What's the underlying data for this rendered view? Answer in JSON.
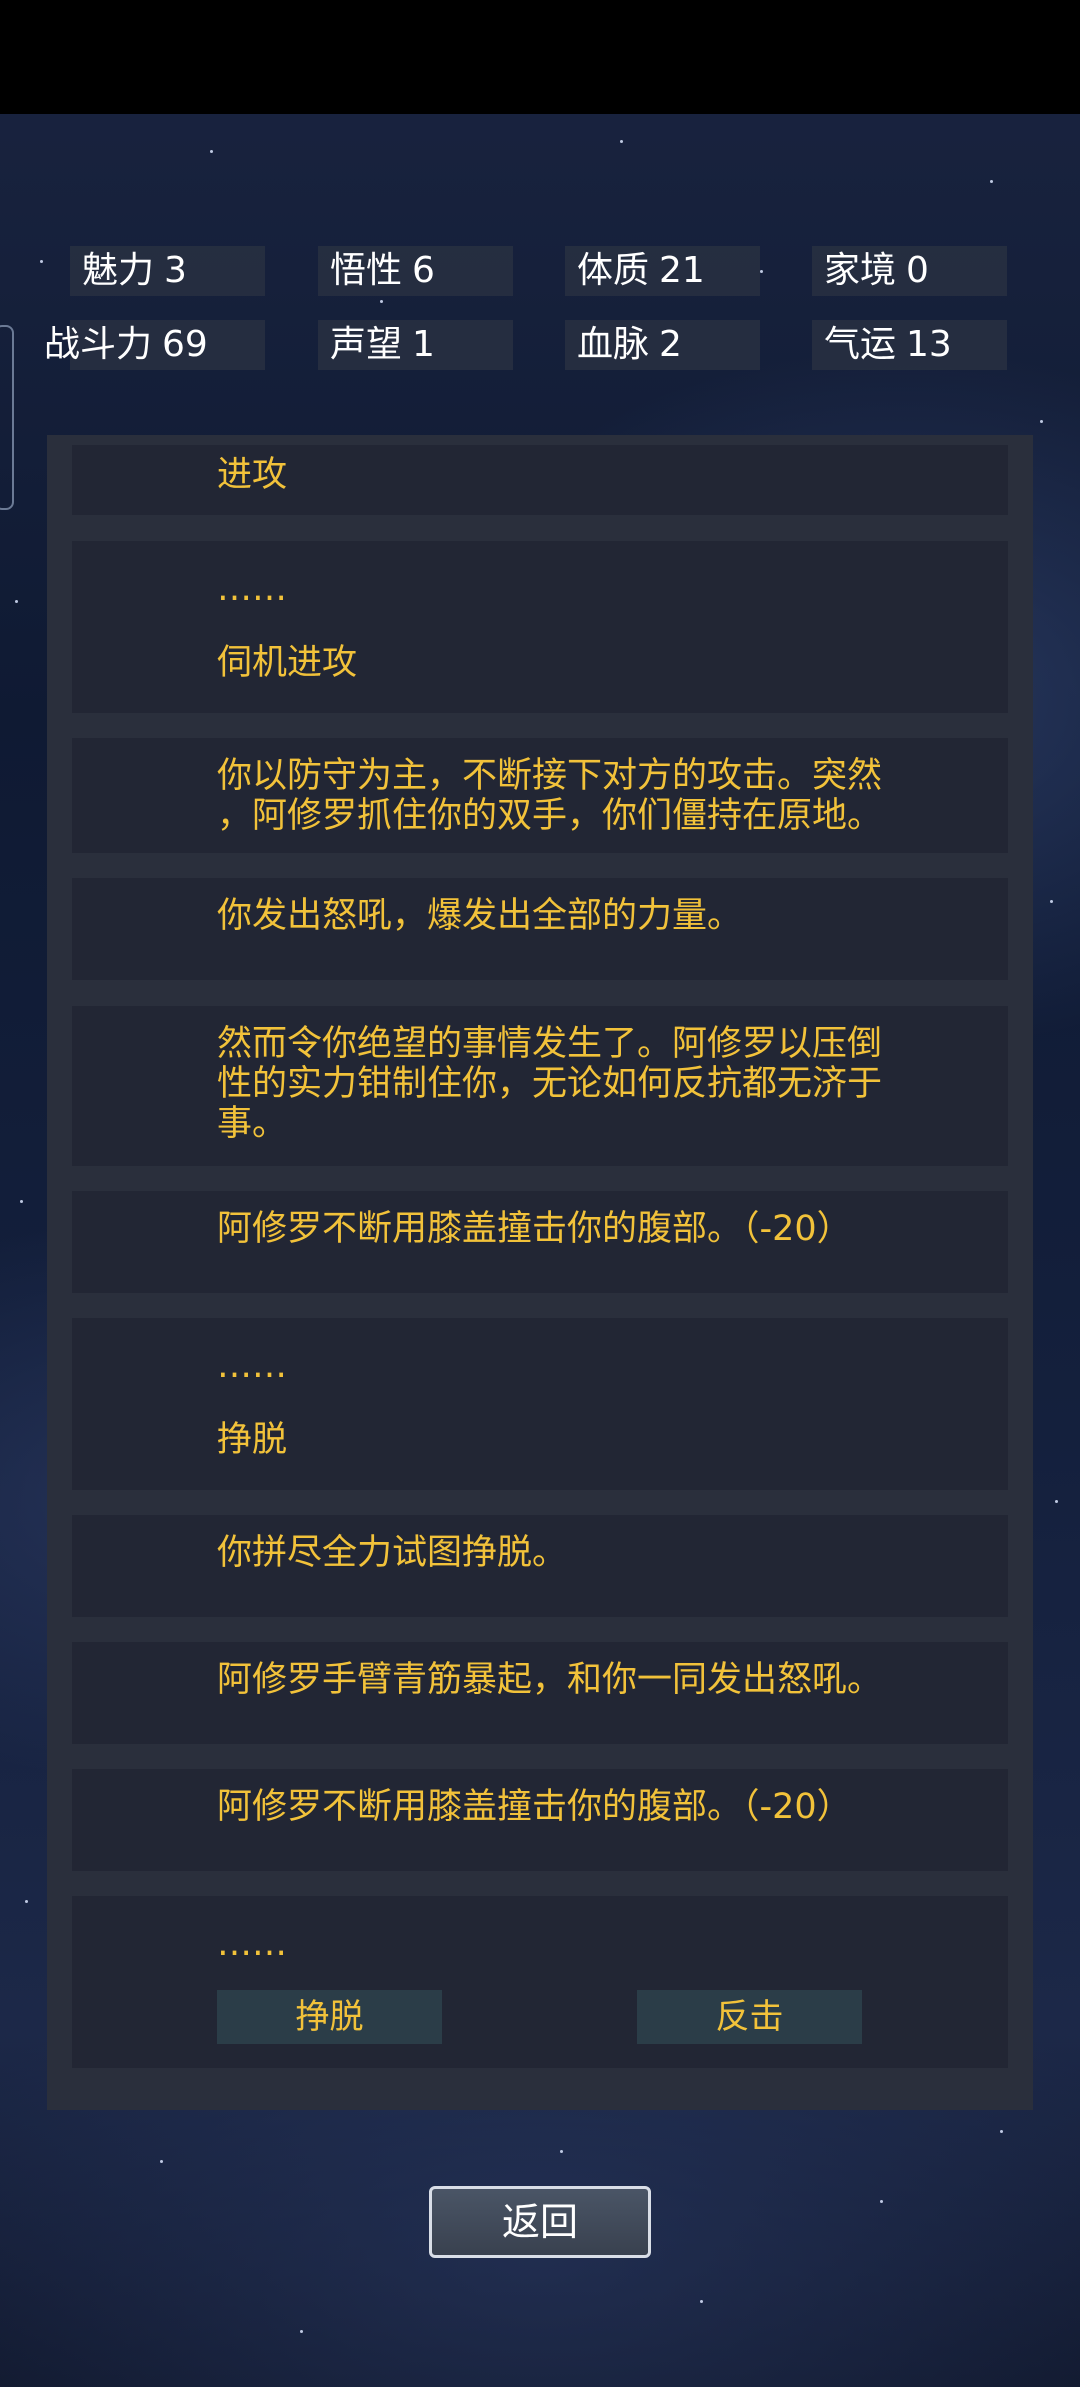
{
  "stats": [
    {
      "name": "魅力",
      "value": "3"
    },
    {
      "name": "悟性",
      "value": "6"
    },
    {
      "name": "体质",
      "value": "21"
    },
    {
      "name": "家境",
      "value": "0"
    },
    {
      "name": "战斗力",
      "value": "69"
    },
    {
      "name": "声望",
      "value": "1"
    },
    {
      "name": "血脉",
      "value": "2"
    },
    {
      "name": "气运",
      "value": "13"
    }
  ],
  "log": [
    {
      "lines": [
        "进攻"
      ]
    },
    {
      "lines": [
        "……",
        "伺机进攻"
      ]
    },
    {
      "lines": [
        "你以防守为主，不断接下对方的攻击。突然",
        "，阿修罗抓住你的双手，你们僵持在原地。"
      ]
    },
    {
      "lines": [
        "你发出怒吼，爆发出全部的力量。"
      ]
    },
    {
      "lines": [
        "然而令你绝望的事情发生了。阿修罗以压倒",
        "性的实力钳制住你，无论如何反抗都无济于",
        "事。"
      ]
    },
    {
      "lines": [
        "阿修罗不断用膝盖撞击你的腹部。（-20）"
      ]
    },
    {
      "lines": [
        "……",
        "挣脱"
      ]
    },
    {
      "lines": [
        "你拼尽全力试图挣脱。"
      ]
    },
    {
      "lines": [
        "阿修罗手臂青筋暴起，和你一同发出怒吼。"
      ]
    },
    {
      "lines": [
        "阿修罗不断用膝盖撞击你的腹部。（-20）"
      ]
    },
    {
      "lines": [
        "……"
      ]
    }
  ],
  "choices": [
    "挣脱",
    "反击"
  ],
  "back_label": "返回"
}
